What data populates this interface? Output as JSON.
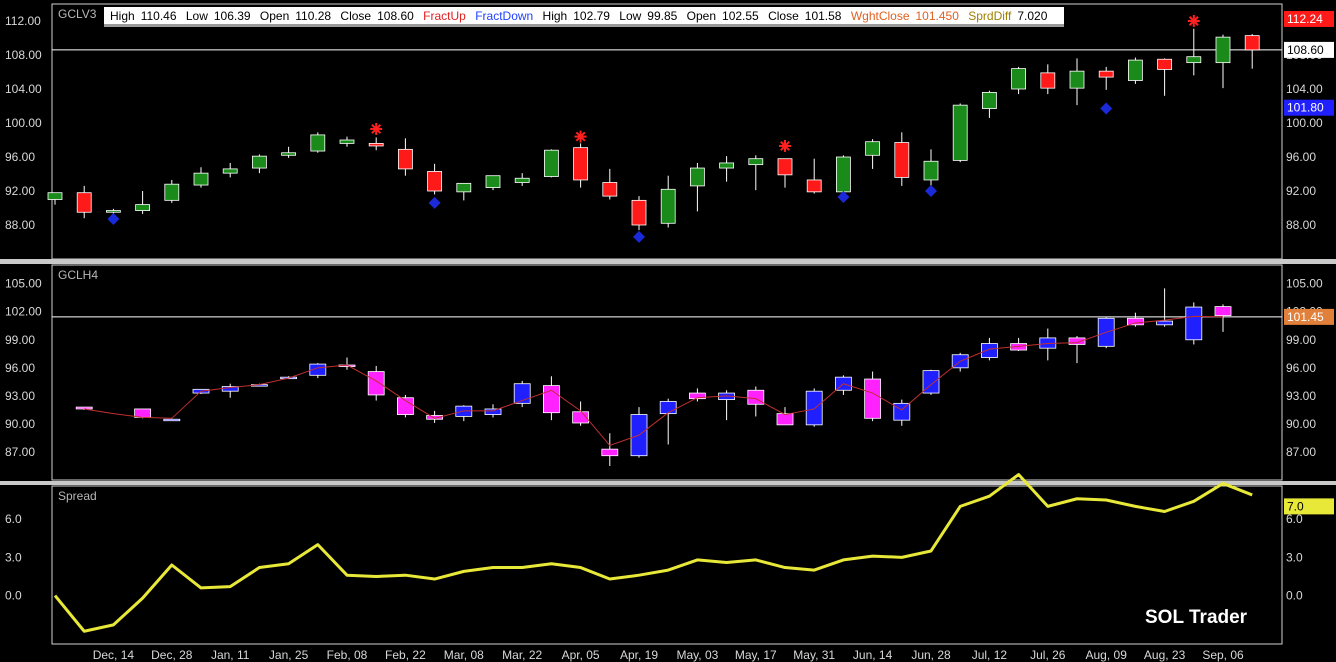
{
  "colors": {
    "bull": "#1a8a1a",
    "bear": "#ff1a1a",
    "blue": "#2020ff",
    "magenta": "#ff22ff",
    "spread": "#e8e838",
    "grid": "#ffffff",
    "fractal_up": "#ff2020",
    "fractal_down": "#1a2ad8"
  },
  "infobar": {
    "high_label": "High",
    "high": "110.46",
    "low_label": "Low",
    "low": "106.39",
    "open_label": "Open",
    "open": "110.28",
    "close_label": "Close",
    "close": "108.60",
    "fract_up": "FractUp",
    "fract_down": "FractDown",
    "high2_label": "High",
    "high2": "102.79",
    "low2_label": "Low",
    "low2": "99.85",
    "open2_label": "Open",
    "open2": "102.55",
    "close2_label": "Close",
    "close2": "101.58",
    "wght_label": "WghtClose",
    "wght": "101.450",
    "sprd_label": "SprdDiff",
    "sprd": "7.020"
  },
  "brand": "SOL Trader",
  "chart_data": [
    {
      "type": "candlestick",
      "title": "GCLV3",
      "ylim": [
        84,
        114
      ],
      "yticks": [
        "112.00",
        "108.00",
        "104.00",
        "100.00",
        "96.00",
        "92.00",
        "88.00"
      ],
      "last_line": 108.6,
      "badges": [
        {
          "value": 112.24,
          "text": "112.24",
          "color": "#ff1a1a"
        },
        {
          "value": 108.6,
          "text": "108.60",
          "color": "#ffffff"
        },
        {
          "value": 101.8,
          "text": "101.80",
          "color": "#2020ff"
        }
      ],
      "candles": [
        {
          "o": 91.0,
          "h": 91.8,
          "l": 90.4,
          "c": 91.8
        },
        {
          "o": 91.8,
          "h": 92.6,
          "l": 88.8,
          "c": 89.5
        },
        {
          "o": 89.5,
          "h": 89.9,
          "l": 89.3,
          "c": 89.7
        },
        {
          "o": 89.7,
          "h": 92.0,
          "l": 89.3,
          "c": 90.4
        },
        {
          "o": 90.9,
          "h": 93.3,
          "l": 90.6,
          "c": 92.8
        },
        {
          "o": 92.7,
          "h": 94.8,
          "l": 92.4,
          "c": 94.1
        },
        {
          "o": 94.1,
          "h": 95.3,
          "l": 93.6,
          "c": 94.6
        },
        {
          "o": 94.7,
          "h": 96.3,
          "l": 94.1,
          "c": 96.1
        },
        {
          "o": 96.2,
          "h": 97.2,
          "l": 95.9,
          "c": 96.5
        },
        {
          "o": 96.7,
          "h": 98.9,
          "l": 96.5,
          "c": 98.6
        },
        {
          "o": 97.6,
          "h": 98.4,
          "l": 97.2,
          "c": 98.0
        },
        {
          "o": 97.6,
          "h": 98.3,
          "l": 96.8,
          "c": 97.3
        },
        {
          "o": 96.9,
          "h": 98.2,
          "l": 93.8,
          "c": 94.6
        },
        {
          "o": 94.3,
          "h": 95.2,
          "l": 91.6,
          "c": 92.0
        },
        {
          "o": 91.9,
          "h": 92.9,
          "l": 90.9,
          "c": 92.9
        },
        {
          "o": 92.4,
          "h": 93.8,
          "l": 92.1,
          "c": 93.8
        },
        {
          "o": 93.0,
          "h": 94.1,
          "l": 92.6,
          "c": 93.5
        },
        {
          "o": 93.7,
          "h": 96.9,
          "l": 93.6,
          "c": 96.8
        },
        {
          "o": 97.1,
          "h": 97.6,
          "l": 92.4,
          "c": 93.3
        },
        {
          "o": 93.0,
          "h": 94.6,
          "l": 91.0,
          "c": 91.4
        },
        {
          "o": 90.9,
          "h": 91.4,
          "l": 87.4,
          "c": 88.0
        },
        {
          "o": 88.2,
          "h": 93.8,
          "l": 87.7,
          "c": 92.2
        },
        {
          "o": 92.6,
          "h": 95.3,
          "l": 89.6,
          "c": 94.7
        },
        {
          "o": 94.7,
          "h": 96.1,
          "l": 93.1,
          "c": 95.3
        },
        {
          "o": 95.1,
          "h": 96.2,
          "l": 92.1,
          "c": 95.8
        },
        {
          "o": 95.8,
          "h": 95.8,
          "l": 92.4,
          "c": 93.9
        },
        {
          "o": 93.3,
          "h": 95.8,
          "l": 91.7,
          "c": 91.9
        },
        {
          "o": 91.9,
          "h": 96.2,
          "l": 91.6,
          "c": 96.0
        },
        {
          "o": 96.2,
          "h": 98.1,
          "l": 94.6,
          "c": 97.8
        },
        {
          "o": 97.7,
          "h": 98.9,
          "l": 92.6,
          "c": 93.6
        },
        {
          "o": 93.3,
          "h": 96.9,
          "l": 92.1,
          "c": 95.5
        },
        {
          "o": 95.6,
          "h": 102.3,
          "l": 95.4,
          "c": 102.1
        },
        {
          "o": 101.7,
          "h": 103.8,
          "l": 100.6,
          "c": 103.6
        },
        {
          "o": 104.0,
          "h": 106.6,
          "l": 103.4,
          "c": 106.4
        },
        {
          "o": 105.9,
          "h": 106.9,
          "l": 103.4,
          "c": 104.1
        },
        {
          "o": 104.1,
          "h": 107.6,
          "l": 102.1,
          "c": 106.1
        },
        {
          "o": 106.1,
          "h": 106.6,
          "l": 103.9,
          "c": 105.4
        },
        {
          "o": 105.0,
          "h": 107.7,
          "l": 104.6,
          "c": 107.4
        },
        {
          "o": 107.5,
          "h": 107.6,
          "l": 103.2,
          "c": 106.3
        },
        {
          "o": 107.1,
          "h": 111.1,
          "l": 105.6,
          "c": 107.8
        },
        {
          "o": 107.1,
          "h": 110.4,
          "l": 104.1,
          "c": 110.1
        },
        {
          "o": 110.28,
          "h": 110.46,
          "l": 106.39,
          "c": 108.6
        }
      ],
      "fractals_up": [
        {
          "i": 11,
          "v": 99.3
        },
        {
          "i": 18,
          "v": 98.4
        },
        {
          "i": 25,
          "v": 97.3
        },
        {
          "i": 39,
          "v": 112.0
        }
      ],
      "fractals_down": [
        {
          "i": 2,
          "v": 88.7
        },
        {
          "i": 13,
          "v": 90.6
        },
        {
          "i": 20,
          "v": 86.6
        },
        {
          "i": 27,
          "v": 91.3
        },
        {
          "i": 30,
          "v": 92.0
        },
        {
          "i": 36,
          "v": 101.7
        }
      ]
    },
    {
      "type": "candlestick",
      "title": "GCLH4",
      "ylim": [
        84,
        107
      ],
      "yticks": [
        "105.00",
        "102.00",
        "99.00",
        "96.00",
        "93.00",
        "90.00",
        "87.00"
      ],
      "last_line": 101.45,
      "badges": [
        {
          "value": 101.45,
          "text": "101.45",
          "color": "#e0803a"
        }
      ],
      "candles": [
        {
          "o": 91.8,
          "h": 91.8,
          "l": 91.5,
          "c": 91.6
        },
        null,
        {
          "o": 91.6,
          "h": 91.6,
          "l": 90.6,
          "c": 90.7
        },
        {
          "o": 90.5,
          "h": 90.6,
          "l": 90.4,
          "c": 90.5
        },
        {
          "o": 93.3,
          "h": 93.7,
          "l": 93.2,
          "c": 93.7
        },
        {
          "o": 93.5,
          "h": 94.3,
          "l": 92.8,
          "c": 94.0
        },
        {
          "o": 94.2,
          "h": 94.3,
          "l": 94.0,
          "c": 94.2
        },
        {
          "o": 94.9,
          "h": 95.1,
          "l": 94.8,
          "c": 95.0
        },
        {
          "o": 95.2,
          "h": 96.5,
          "l": 94.9,
          "c": 96.4
        },
        {
          "o": 96.3,
          "h": 97.1,
          "l": 95.8,
          "c": 96.2
        },
        {
          "o": 95.6,
          "h": 96.2,
          "l": 92.5,
          "c": 93.1
        },
        {
          "o": 92.8,
          "h": 93.1,
          "l": 90.7,
          "c": 91.0
        },
        {
          "o": 90.9,
          "h": 91.4,
          "l": 90.1,
          "c": 90.5
        },
        {
          "o": 90.8,
          "h": 92.0,
          "l": 90.3,
          "c": 91.9
        },
        {
          "o": 91.0,
          "h": 92.1,
          "l": 90.7,
          "c": 91.6
        },
        {
          "o": 92.2,
          "h": 94.6,
          "l": 91.8,
          "c": 94.3
        },
        {
          "o": 94.1,
          "h": 95.1,
          "l": 90.4,
          "c": 91.2
        },
        {
          "o": 91.3,
          "h": 92.4,
          "l": 89.8,
          "c": 90.1
        },
        {
          "o": 87.3,
          "h": 89.0,
          "l": 85.5,
          "c": 86.6
        },
        {
          "o": 86.6,
          "h": 91.8,
          "l": 86.4,
          "c": 91.0
        },
        {
          "o": 91.1,
          "h": 92.7,
          "l": 87.8,
          "c": 92.4
        },
        {
          "o": 93.3,
          "h": 93.8,
          "l": 92.4,
          "c": 92.7
        },
        {
          "o": 92.6,
          "h": 93.6,
          "l": 90.4,
          "c": 93.3
        },
        {
          "o": 93.6,
          "h": 94.0,
          "l": 90.8,
          "c": 92.1
        },
        {
          "o": 91.1,
          "h": 91.8,
          "l": 90.3,
          "c": 89.9
        },
        {
          "o": 89.9,
          "h": 93.8,
          "l": 89.7,
          "c": 93.5
        },
        {
          "o": 93.6,
          "h": 95.2,
          "l": 93.1,
          "c": 95.0
        },
        {
          "o": 94.8,
          "h": 95.6,
          "l": 90.3,
          "c": 90.6
        },
        {
          "o": 90.4,
          "h": 92.6,
          "l": 89.8,
          "c": 92.2
        },
        {
          "o": 93.3,
          "h": 95.8,
          "l": 93.1,
          "c": 95.7
        },
        {
          "o": 96.0,
          "h": 97.6,
          "l": 95.6,
          "c": 97.4
        },
        {
          "o": 97.1,
          "h": 99.2,
          "l": 96.8,
          "c": 98.6
        },
        {
          "o": 98.6,
          "h": 99.2,
          "l": 97.8,
          "c": 97.9
        },
        {
          "o": 98.1,
          "h": 100.2,
          "l": 96.8,
          "c": 99.2
        },
        {
          "o": 99.2,
          "h": 99.4,
          "l": 96.5,
          "c": 98.5
        },
        {
          "o": 98.3,
          "h": 101.4,
          "l": 98.1,
          "c": 101.3
        },
        {
          "o": 101.3,
          "h": 101.9,
          "l": 100.4,
          "c": 100.6
        },
        {
          "o": 100.6,
          "h": 104.5,
          "l": 100.4,
          "c": 101.0
        },
        {
          "o": 99.0,
          "h": 103.0,
          "l": 98.5,
          "c": 102.5
        },
        {
          "o": 102.55,
          "h": 102.79,
          "l": 99.85,
          "c": 101.58
        }
      ],
      "wght_line": [
        91.6,
        91.1,
        90.7,
        90.6,
        93.5,
        93.9,
        94.2,
        94.9,
        96.0,
        96.3,
        94.6,
        92.5,
        90.6,
        91.4,
        91.4,
        92.5,
        93.6,
        91.4,
        87.7,
        88.8,
        91.2,
        92.8,
        93.0,
        92.7,
        91.0,
        91.6,
        94.3,
        93.3,
        91.5,
        94.2,
        96.7,
        98.0,
        98.3,
        98.6,
        98.7,
        99.8,
        100.8,
        101.1,
        101.5,
        101.45
      ],
      "yellow_box_i": 36
    },
    {
      "type": "line",
      "title": "Spread",
      "ylim": [
        -3.8,
        8.6
      ],
      "yticks": [
        "6.0",
        "3.0",
        "0.0"
      ],
      "badges": [
        {
          "value": 7.0,
          "text": "7.0",
          "color": "#e8e838"
        }
      ],
      "values": [
        0.0,
        -2.8,
        -2.3,
        -0.2,
        2.4,
        0.6,
        0.7,
        2.2,
        2.5,
        4.0,
        1.6,
        1.5,
        1.6,
        1.3,
        1.9,
        2.2,
        2.2,
        2.5,
        2.2,
        1.3,
        1.6,
        2.0,
        2.8,
        2.6,
        2.8,
        2.2,
        2.0,
        2.8,
        3.1,
        3.0,
        3.5,
        7.0,
        7.8,
        9.5,
        7.0,
        7.6,
        7.5,
        7.0,
        6.6,
        7.4,
        8.8,
        7.9
      ]
    }
  ],
  "xaxis": {
    "labels": [
      "Dec, 14",
      "Dec, 28",
      "Jan, 11",
      "Jan, 25",
      "Feb, 08",
      "Feb, 22",
      "Mar, 08",
      "Mar, 22",
      "Apr, 05",
      "Apr, 19",
      "May, 03",
      "May, 17",
      "May, 31",
      "Jun, 14",
      "Jun, 28",
      "Jul, 12",
      "Jul, 26",
      "Aug, 09",
      "Aug, 23",
      "Sep, 06"
    ]
  }
}
